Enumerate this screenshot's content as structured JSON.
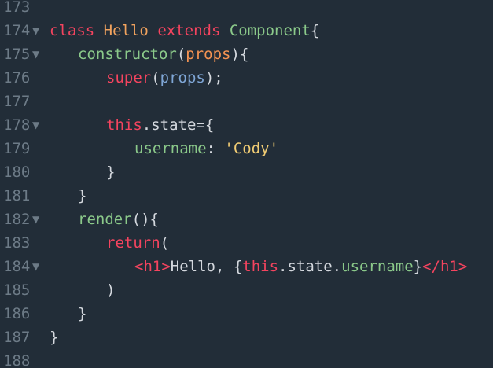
{
  "editor": {
    "colors": {
      "background": "#222d38",
      "line_number": "#6d7b87",
      "keyword": "#f5445f",
      "class_name": "#f2a35e",
      "component": "#8bc98a",
      "param": "#f49352",
      "param_ref": "#7fa6d6",
      "string": "#f2cd74",
      "text": "#d4d8de"
    },
    "fold_icon": "fold-triangle-down",
    "lines": [
      {
        "number": "173",
        "foldable": false,
        "indent": 0,
        "tokens": []
      },
      {
        "number": "174",
        "foldable": true,
        "indent": 0,
        "tokens": [
          {
            "text": "class",
            "type": "keyword"
          },
          {
            "text": " ",
            "type": "plain"
          },
          {
            "text": "Hello",
            "type": "classname"
          },
          {
            "text": " ",
            "type": "plain"
          },
          {
            "text": "extends",
            "type": "keyword"
          },
          {
            "text": " ",
            "type": "plain"
          },
          {
            "text": "Component",
            "type": "component"
          },
          {
            "text": "{",
            "type": "plain"
          }
        ]
      },
      {
        "number": "175",
        "foldable": true,
        "indent": 1,
        "tokens": [
          {
            "text": "constructor",
            "type": "method"
          },
          {
            "text": "(",
            "type": "plain"
          },
          {
            "text": "props",
            "type": "param"
          },
          {
            "text": "){",
            "type": "plain"
          }
        ]
      },
      {
        "number": "176",
        "foldable": false,
        "indent": 2,
        "tokens": [
          {
            "text": "super",
            "type": "keyword"
          },
          {
            "text": "(",
            "type": "plain"
          },
          {
            "text": "props",
            "type": "paramref"
          },
          {
            "text": ");",
            "type": "plain"
          }
        ]
      },
      {
        "number": "177",
        "foldable": false,
        "indent": 0,
        "tokens": []
      },
      {
        "number": "178",
        "foldable": true,
        "indent": 2,
        "tokens": [
          {
            "text": "this",
            "type": "keyword"
          },
          {
            "text": ".state={",
            "type": "plain"
          }
        ]
      },
      {
        "number": "179",
        "foldable": false,
        "indent": 3,
        "tokens": [
          {
            "text": "username",
            "type": "component"
          },
          {
            "text": ": ",
            "type": "plain"
          },
          {
            "text": "'Cody'",
            "type": "string"
          }
        ]
      },
      {
        "number": "180",
        "foldable": false,
        "indent": 2,
        "tokens": [
          {
            "text": "}",
            "type": "plain"
          }
        ]
      },
      {
        "number": "181",
        "foldable": false,
        "indent": 1,
        "tokens": [
          {
            "text": "}",
            "type": "plain"
          }
        ]
      },
      {
        "number": "182",
        "foldable": true,
        "indent": 1,
        "tokens": [
          {
            "text": "render",
            "type": "method"
          },
          {
            "text": "(){",
            "type": "plain"
          }
        ]
      },
      {
        "number": "183",
        "foldable": false,
        "indent": 2,
        "tokens": [
          {
            "text": "return",
            "type": "keyword"
          },
          {
            "text": "(",
            "type": "plain"
          }
        ]
      },
      {
        "number": "184",
        "foldable": true,
        "indent": 3,
        "tokens": [
          {
            "text": "<h1>",
            "type": "tag"
          },
          {
            "text": "Hello, {",
            "type": "plain"
          },
          {
            "text": "this",
            "type": "keyword"
          },
          {
            "text": ".state.",
            "type": "plain"
          },
          {
            "text": "username",
            "type": "component"
          },
          {
            "text": "}",
            "type": "plain"
          },
          {
            "text": "</h1>",
            "type": "tag"
          }
        ]
      },
      {
        "number": "185",
        "foldable": false,
        "indent": 2,
        "tokens": [
          {
            "text": ")",
            "type": "plain"
          }
        ]
      },
      {
        "number": "186",
        "foldable": false,
        "indent": 1,
        "tokens": [
          {
            "text": "}",
            "type": "plain"
          }
        ]
      },
      {
        "number": "187",
        "foldable": false,
        "indent": 0,
        "tokens": [
          {
            "text": "}",
            "type": "plain"
          }
        ]
      },
      {
        "number": "188",
        "foldable": false,
        "indent": 0,
        "tokens": []
      }
    ]
  }
}
